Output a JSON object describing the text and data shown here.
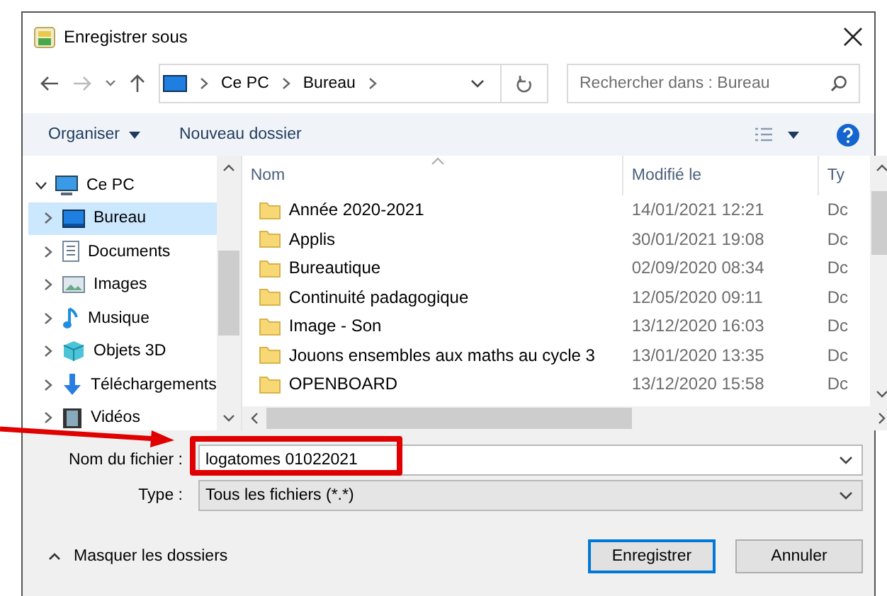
{
  "window": {
    "title": "Enregistrer sous"
  },
  "address": {
    "crumbs": [
      "Ce PC",
      "Bureau"
    ]
  },
  "search": {
    "placeholder": "Rechercher dans : Bureau"
  },
  "toolbar": {
    "organize": "Organiser",
    "new_folder": "Nouveau dossier"
  },
  "nav": {
    "items": [
      {
        "label": "Ce PC",
        "kind": "pc",
        "expanded": true,
        "children": [
          {
            "label": "Bureau",
            "kind": "desktop",
            "selected": true
          },
          {
            "label": "Documents",
            "kind": "documents",
            "selected": false
          },
          {
            "label": "Images",
            "kind": "images",
            "selected": false
          },
          {
            "label": "Musique",
            "kind": "music",
            "selected": false
          },
          {
            "label": "Objets 3D",
            "kind": "objects3d",
            "selected": false
          },
          {
            "label": "Téléchargements",
            "kind": "downloads",
            "selected": false
          },
          {
            "label": "Vidéos",
            "kind": "videos",
            "selected": false
          }
        ]
      }
    ]
  },
  "files": {
    "columns": [
      "Nom",
      "Modifié le",
      "Ty"
    ],
    "rows": [
      {
        "name": "Année 2020-2021",
        "modified": "14/01/2021 12:21",
        "type": "Dc"
      },
      {
        "name": "Applis",
        "modified": "30/01/2021 19:08",
        "type": "Dc"
      },
      {
        "name": "Bureautique",
        "modified": "02/09/2020 08:34",
        "type": "Dc"
      },
      {
        "name": "Continuité padagogique",
        "modified": "12/05/2020 09:11",
        "type": "Dc"
      },
      {
        "name": "Image - Son",
        "modified": "13/12/2020 16:03",
        "type": "Dc"
      },
      {
        "name": "Jouons ensembles aux maths au cycle 3",
        "modified": "13/01/2020 13:35",
        "type": "Dc"
      },
      {
        "name": "OPENBOARD",
        "modified": "13/12/2020 15:58",
        "type": "Dc"
      }
    ]
  },
  "filename": {
    "label": "Nom du fichier :",
    "value": "logatomes 01022021",
    "highlighted": true
  },
  "filetype": {
    "label": "Type :",
    "value": "Tous les fichiers (*.*)"
  },
  "hide_folders": "Masquer les dossiers",
  "buttons": [
    {
      "label": "Enregistrer",
      "default": true
    },
    {
      "label": "Annuler",
      "default": false
    }
  ]
}
